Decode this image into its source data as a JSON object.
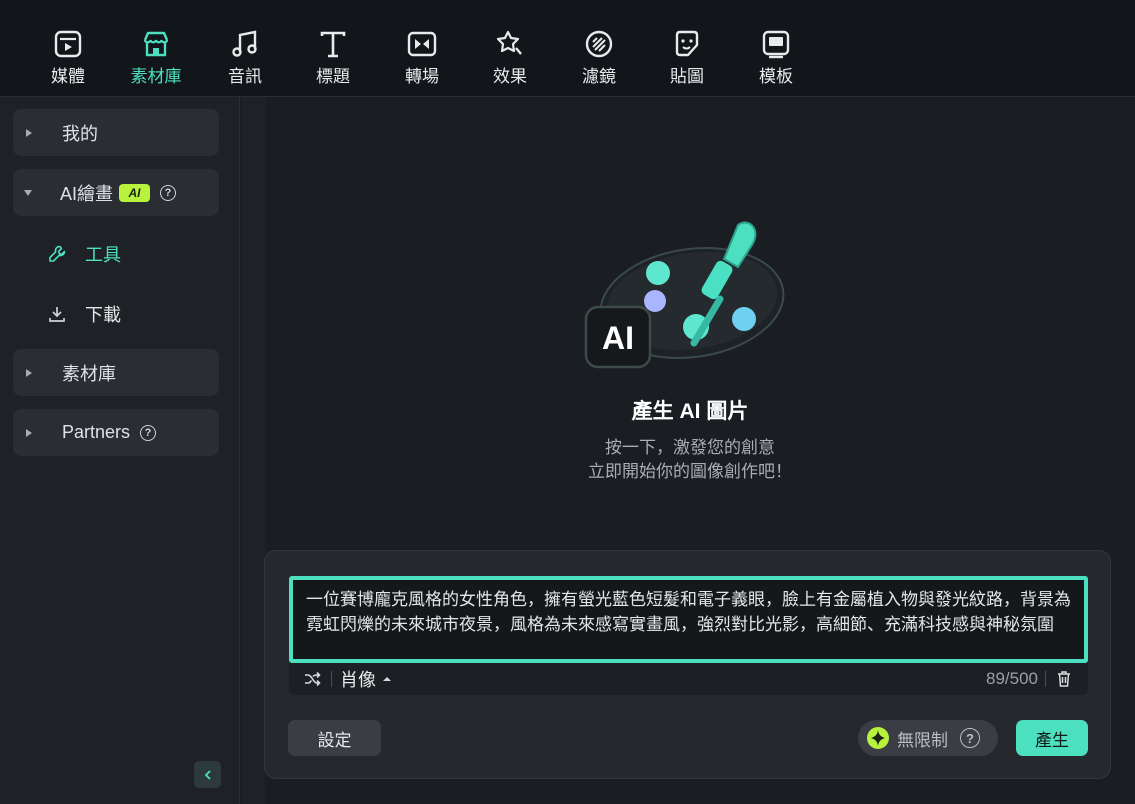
{
  "toolbar": {
    "items": [
      {
        "label": "媒體",
        "icon": "media-icon"
      },
      {
        "label": "素材庫",
        "icon": "store-icon"
      },
      {
        "label": "音訊",
        "icon": "music-icon"
      },
      {
        "label": "標題",
        "icon": "title-icon"
      },
      {
        "label": "轉場",
        "icon": "transition-icon"
      },
      {
        "label": "效果",
        "icon": "effects-icon"
      },
      {
        "label": "濾鏡",
        "icon": "filter-icon"
      },
      {
        "label": "貼圖",
        "icon": "sticker-icon"
      },
      {
        "label": "模板",
        "icon": "template-icon"
      }
    ],
    "active_index": 1
  },
  "sidebar": {
    "mine": "我的",
    "ai_paint": "AI繪畫",
    "ai_badge": "AI",
    "tools": "工具",
    "download": "下載",
    "library": "素材庫",
    "partners": "Partners"
  },
  "main": {
    "hero_badge": "AI",
    "title": "產生 AI 圖片",
    "subtitle_line1": "按一下，激發您的創意",
    "subtitle_line2": "立即開始你的圖像創作吧！",
    "prompt": "一位賽博龐克風格的女性角色，擁有螢光藍色短髮和電子義眼，臉上有金屬植入物與發光紋路，背景為霓虹閃爍的未來城市夜景，風格為未來感寫實畫風，強烈對比光影，高細節、充滿科技感與神秘氛圍",
    "style": "肖像",
    "counter": "89/500",
    "settings": "設定",
    "unlimited": "無限制",
    "generate": "產生"
  },
  "colors": {
    "accent": "#4de0c0",
    "ai_badge": "#b8f23c",
    "background": "#1a1d21",
    "panel": "#25282d"
  }
}
